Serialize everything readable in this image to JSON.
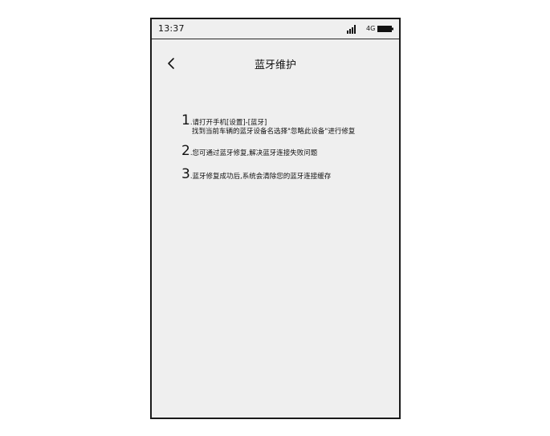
{
  "status_bar": {
    "time": "13:37",
    "network": "4G",
    "signal_icon": "signal-bars-icon",
    "battery_icon": "battery-icon"
  },
  "header": {
    "title": "蓝牙维护",
    "back_icon": "chevron-left-icon"
  },
  "steps": [
    {
      "number": "1",
      "text": ".请打开手机[设置]-[蓝牙]",
      "subtext": "找到当前车辆的蓝牙设备名选择\"忽略此设备\"进行修复"
    },
    {
      "number": "2",
      "text": ".您可通过蓝牙修复,解决蓝牙连接失败问题"
    },
    {
      "number": "3",
      "text": ".蓝牙修复成功后,系统会清除您的蓝牙连接缓存"
    }
  ]
}
